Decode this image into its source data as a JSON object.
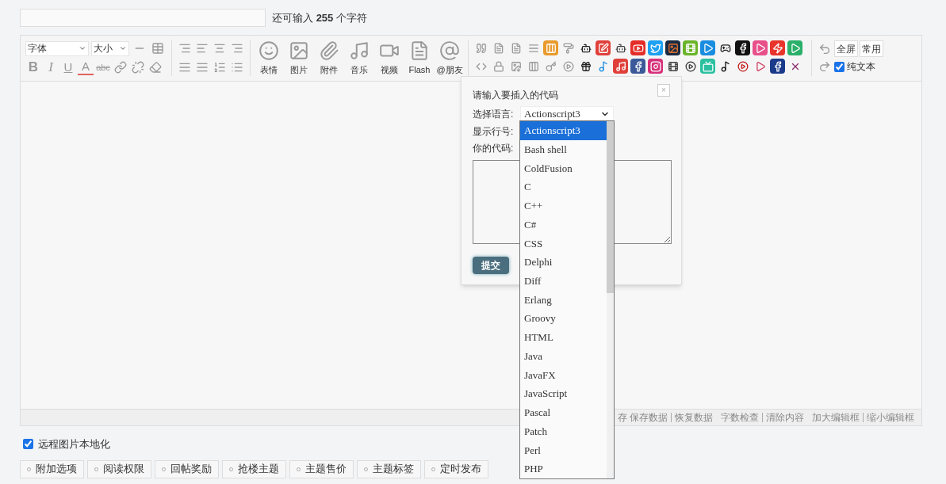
{
  "title_counter": "还可输入 **255** 个字符",
  "toolbar": {
    "font_select": "字体",
    "size_select": "大小",
    "format_glyphs": [
      "B",
      "I",
      "U",
      "A",
      "abc"
    ],
    "media_buttons": [
      "表情",
      "图片",
      "附件",
      "音乐",
      "视频",
      "Flash",
      "@朋友"
    ],
    "fullscreen": "全屏",
    "common": "常用",
    "plain_text": {
      "label": "纯文本",
      "checked": true
    }
  },
  "status_prefix": "存",
  "status_groups": [
    [
      "保存数据",
      "恢复数据"
    ],
    [
      "字数检查",
      "清除内容"
    ],
    [
      "加大编辑框",
      "缩小编辑框"
    ]
  ],
  "code_dialog": {
    "title": "请输入要插入的代码",
    "close": "×",
    "language_label": "选择语言:",
    "language_value": "Actionscript3",
    "line_numbers_label": "显示行号:",
    "code_label": "你的代码:",
    "submit": "提交"
  },
  "language_dropdown": [
    {
      "label": "Actionscript3",
      "selected": true
    },
    {
      "label": "Bash shell",
      "selected": false
    },
    {
      "label": "ColdFusion",
      "selected": false
    },
    {
      "label": "C",
      "selected": false
    },
    {
      "label": "C++",
      "selected": false
    },
    {
      "label": "C#",
      "selected": false
    },
    {
      "label": "CSS",
      "selected": false
    },
    {
      "label": "Delphi",
      "selected": false
    },
    {
      "label": "Diff",
      "selected": false
    },
    {
      "label": "Erlang",
      "selected": false
    },
    {
      "label": "Groovy",
      "selected": false
    },
    {
      "label": "HTML",
      "selected": false
    },
    {
      "label": "Java",
      "selected": false
    },
    {
      "label": "JavaFX",
      "selected": false
    },
    {
      "label": "JavaScript",
      "selected": false
    },
    {
      "label": "Pascal",
      "selected": false
    },
    {
      "label": "Patch",
      "selected": false
    },
    {
      "label": "Perl",
      "selected": false
    },
    {
      "label": "PHP",
      "selected": false
    }
  ],
  "remote_images": {
    "label": "远程图片本地化",
    "checked": true
  },
  "option_tabs": [
    "附加选项",
    "阅读权限",
    "回帖奖励",
    "抢楼主题",
    "主题售价",
    "主题标签",
    "定时发布"
  ]
}
